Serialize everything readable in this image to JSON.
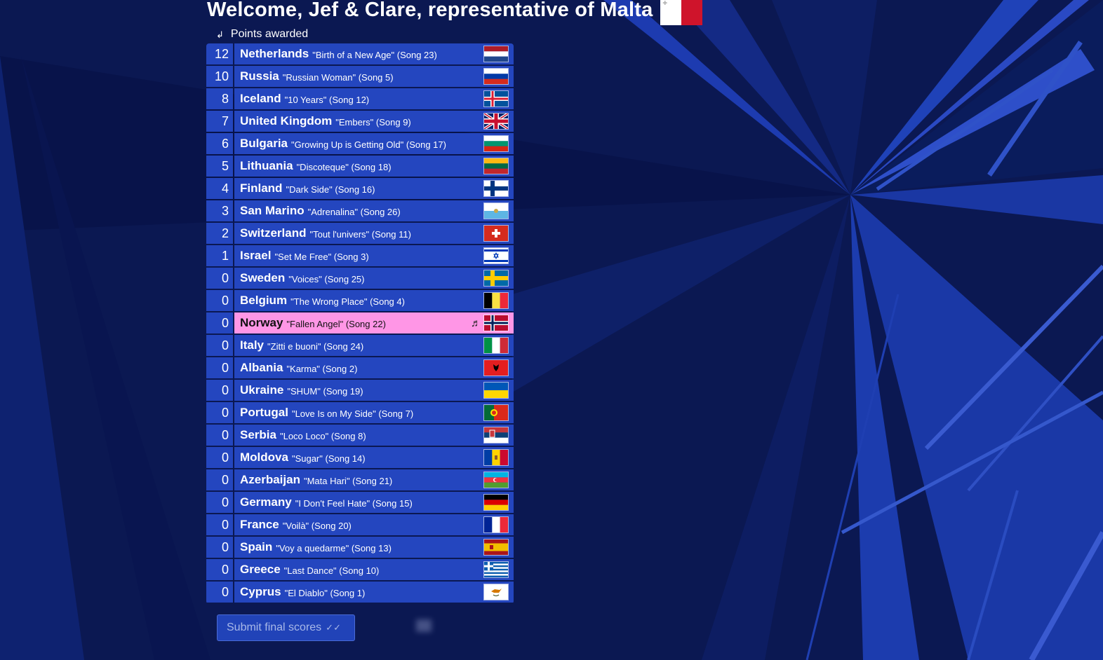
{
  "header": {
    "title": "Welcome, Jef & Clare, representative of Malta",
    "flag_icon": "malta-flag"
  },
  "subheader": {
    "label": "Points awarded",
    "icon": "return-arrow-icon"
  },
  "entries": [
    {
      "points": "12",
      "country": "Netherlands",
      "song": "\"Birth of a New Age\" (Song 23)",
      "flag": "netherlands"
    },
    {
      "points": "10",
      "country": "Russia",
      "song": "\"Russian Woman\" (Song 5)",
      "flag": "russia"
    },
    {
      "points": "8",
      "country": "Iceland",
      "song": "\"10 Years\" (Song 12)",
      "flag": "iceland"
    },
    {
      "points": "7",
      "country": "United Kingdom",
      "song": "\"Embers\" (Song 9)",
      "flag": "uk"
    },
    {
      "points": "6",
      "country": "Bulgaria",
      "song": "\"Growing Up is Getting Old\" (Song 17)",
      "flag": "bulgaria"
    },
    {
      "points": "5",
      "country": "Lithuania",
      "song": "\"Discoteque\" (Song 18)",
      "flag": "lithuania"
    },
    {
      "points": "4",
      "country": "Finland",
      "song": "\"Dark Side\" (Song 16)",
      "flag": "finland"
    },
    {
      "points": "3",
      "country": "San Marino",
      "song": "\"Adrenalina\" (Song 26)",
      "flag": "sanmarino"
    },
    {
      "points": "2",
      "country": "Switzerland",
      "song": "\"Tout l'univers\" (Song 11)",
      "flag": "switzerland"
    },
    {
      "points": "1",
      "country": "Israel",
      "song": "\"Set Me Free\" (Song 3)",
      "flag": "israel"
    },
    {
      "points": "0",
      "country": "Sweden",
      "song": "\"Voices\" (Song 25)",
      "flag": "sweden"
    },
    {
      "points": "0",
      "country": "Belgium",
      "song": "\"The Wrong Place\" (Song 4)",
      "flag": "belgium"
    },
    {
      "points": "0",
      "country": "Norway",
      "song": "\"Fallen Angel\" (Song 22)",
      "flag": "norway",
      "highlight": true
    },
    {
      "points": "0",
      "country": "Italy",
      "song": "\"Zitti e buoni\" (Song 24)",
      "flag": "italy"
    },
    {
      "points": "0",
      "country": "Albania",
      "song": "\"Karma\" (Song 2)",
      "flag": "albania"
    },
    {
      "points": "0",
      "country": "Ukraine",
      "song": "\"SHUM\" (Song 19)",
      "flag": "ukraine"
    },
    {
      "points": "0",
      "country": "Portugal",
      "song": "\"Love Is on My Side\" (Song 7)",
      "flag": "portugal"
    },
    {
      "points": "0",
      "country": "Serbia",
      "song": "\"Loco Loco\" (Song 8)",
      "flag": "serbia"
    },
    {
      "points": "0",
      "country": "Moldova",
      "song": "\"Sugar\" (Song 14)",
      "flag": "moldova"
    },
    {
      "points": "0",
      "country": "Azerbaijan",
      "song": "\"Mata Hari\" (Song 21)",
      "flag": "azerbaijan"
    },
    {
      "points": "0",
      "country": "Germany",
      "song": "\"I Don't Feel Hate\" (Song 15)",
      "flag": "germany"
    },
    {
      "points": "0",
      "country": "France",
      "song": "\"Voilà\" (Song 20)",
      "flag": "france"
    },
    {
      "points": "0",
      "country": "Spain",
      "song": "\"Voy a quedarme\" (Song 13)",
      "flag": "spain"
    },
    {
      "points": "0",
      "country": "Greece",
      "song": "\"Last Dance\" (Song 10)",
      "flag": "greece"
    },
    {
      "points": "0",
      "country": "Cyprus",
      "song": "\"El Diablo\" (Song 1)",
      "flag": "cyprus"
    }
  ],
  "submit": {
    "label": "Submit final scores",
    "icon": "double-check-icon"
  },
  "colors": {
    "background": "#0a1650",
    "row": "#2446bf",
    "highlight": "#ff96e6"
  }
}
